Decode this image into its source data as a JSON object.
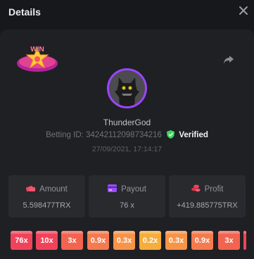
{
  "header": {
    "title": "Details"
  },
  "user": {
    "name": "ThunderGod",
    "betting_id_label": "Betting ID:",
    "betting_id": "34242112098734216",
    "verified_label": "Verified",
    "date": "27/09/2021, 17:14:17"
  },
  "badge": {
    "text": "WIN"
  },
  "stats": [
    {
      "label": "Amount",
      "value": "5.598477TRX",
      "icon": "money-icon"
    },
    {
      "label": "Payout",
      "value": "76 x",
      "icon": "card-icon"
    },
    {
      "label": "Profit",
      "value": "+419.885775TRX",
      "icon": "coins-icon"
    }
  ],
  "multipliers": [
    {
      "label": "76x",
      "color": "#f0435a"
    },
    {
      "label": "10x",
      "color": "#f0435a"
    },
    {
      "label": "3x",
      "color": "#f26450"
    },
    {
      "label": "0.9x",
      "color": "#f57a4e"
    },
    {
      "label": "0.3x",
      "color": "#f79448"
    },
    {
      "label": "0.2x",
      "color": "#f7ad3c"
    },
    {
      "label": "0.3x",
      "color": "#f79448"
    },
    {
      "label": "0.9x",
      "color": "#f57a4e"
    },
    {
      "label": "3x",
      "color": "#f26450"
    },
    {
      "label": "",
      "color": "#f0435a"
    }
  ],
  "colors": {
    "verified": "#3dd65f",
    "avatar_ring": "#9b45ff",
    "background": "#17181b",
    "card": "#1f2024"
  }
}
